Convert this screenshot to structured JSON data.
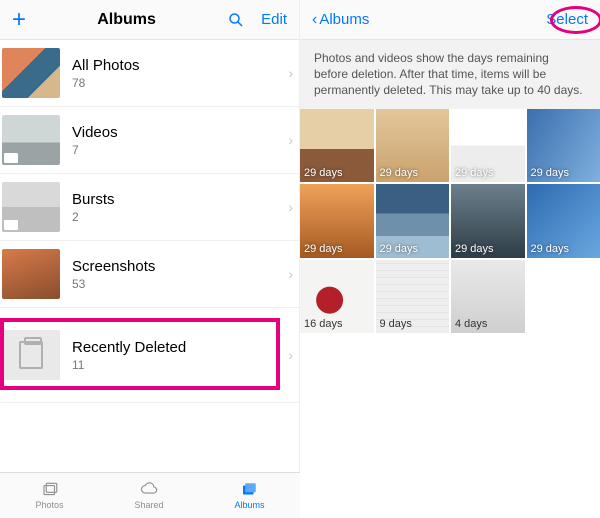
{
  "left": {
    "nav": {
      "title": "Albums",
      "edit": "Edit",
      "plus_icon": "plus-icon",
      "search_icon": "search-icon"
    },
    "albums": [
      {
        "name": "All Photos",
        "count": "78"
      },
      {
        "name": "Videos",
        "count": "7"
      },
      {
        "name": "Bursts",
        "count": "2"
      },
      {
        "name": "Screenshots",
        "count": "53"
      },
      {
        "name": "Recently Deleted",
        "count": "11"
      }
    ]
  },
  "right": {
    "nav": {
      "back": "Albums",
      "select": "Select"
    },
    "banner": "Photos and videos show the days remaining before deletion. After that time, items will be permanently deleted. This may take up to 40 days.",
    "cells": [
      {
        "label": "29 days"
      },
      {
        "label": "29 days"
      },
      {
        "label": "29 days"
      },
      {
        "label": "29 days"
      },
      {
        "label": "29 days"
      },
      {
        "label": "29 days"
      },
      {
        "label": "29 days"
      },
      {
        "label": "29 days"
      },
      {
        "label": "16 days"
      },
      {
        "label": "9 days"
      },
      {
        "label": "4 days"
      }
    ]
  },
  "tabs": [
    {
      "label": "Photos"
    },
    {
      "label": "Shared"
    },
    {
      "label": "Albums"
    }
  ],
  "colors": {
    "accent": "#007aff",
    "highlight": "#e6007e"
  }
}
